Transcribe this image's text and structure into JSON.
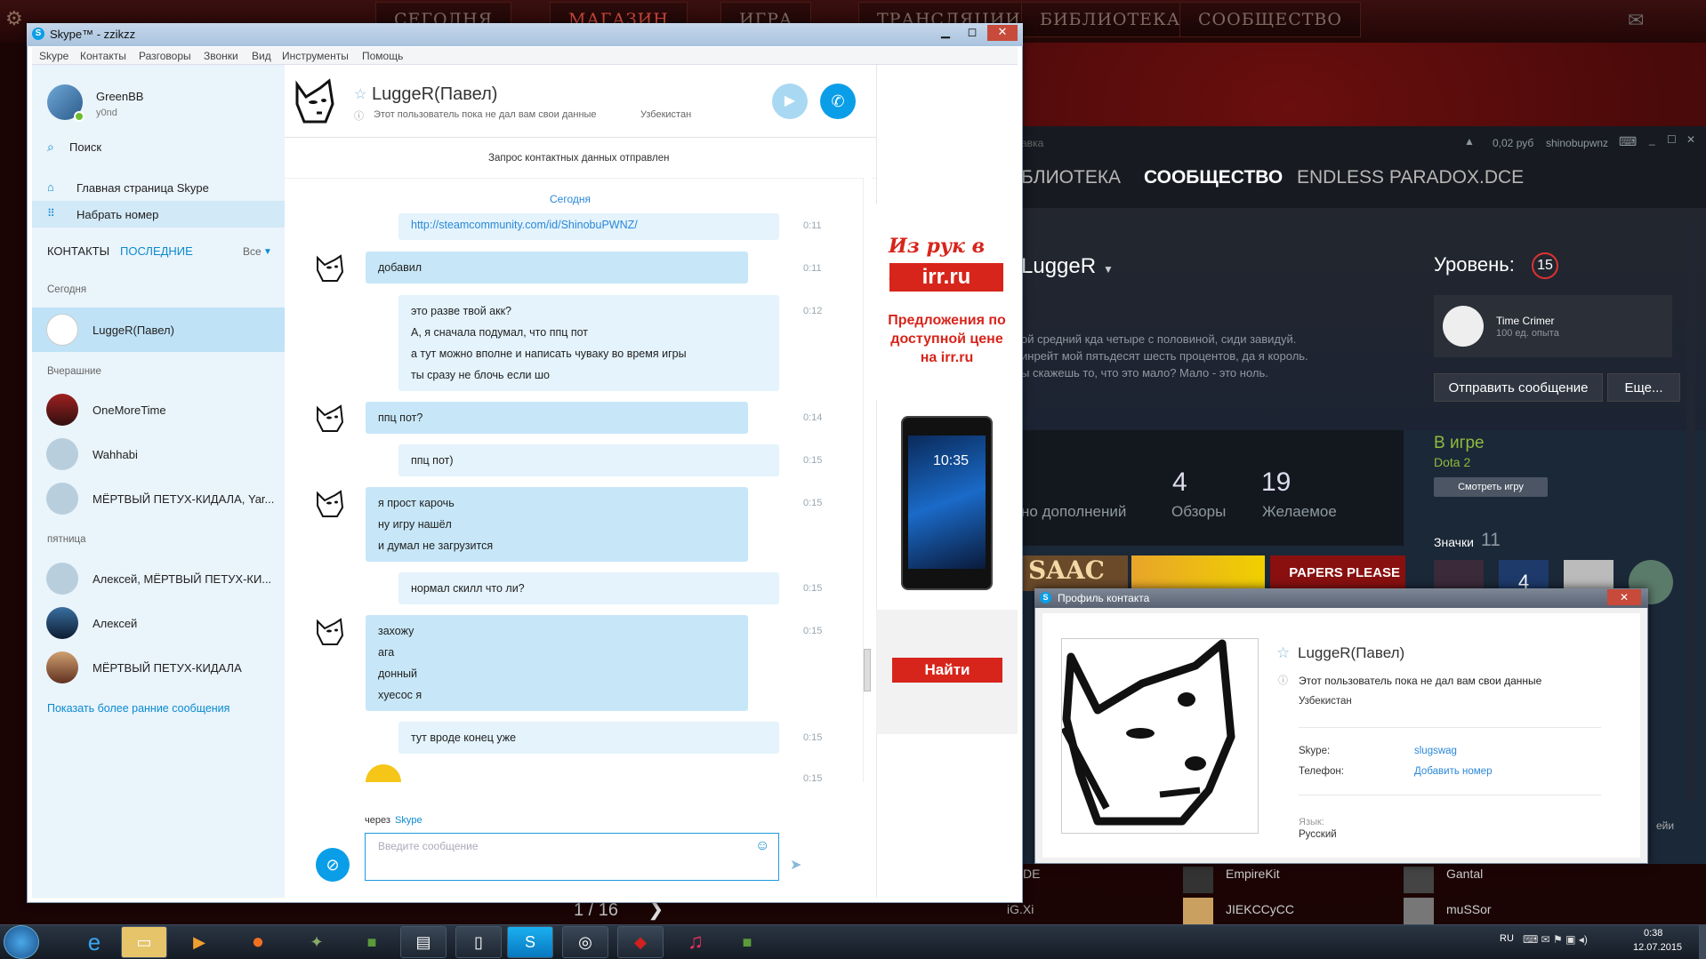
{
  "steam": {
    "tabs": [
      "СЕГОДНЯ",
      "МАГАЗИН",
      "ИГРА",
      "ТРАНСЛЯЦИИ",
      "БИБЛИОТЕКА",
      "СООБЩЕСТВО"
    ],
    "window": {
      "balance": "0,02 руб",
      "account": "shinobupwnz",
      "title_fragment": "авка"
    },
    "nav": [
      "БЛИОТЕКА",
      "СООБЩЕСТВО",
      "ENDLESS PARADOX.DCE"
    ],
    "profile": {
      "name": "LuggeR",
      "bio_lines": [
        "ой средний кда четыре с половиной, сиди завидуй.",
        "инрейт мой пятьдесят шесть процентов, да я король.",
        "ы скажешь то, что это мало? Мало - это ноль."
      ],
      "level_label": "Уровень:",
      "level": "15",
      "badge_name": "Time Crimer",
      "badge_xp": "100 ед. опыта",
      "send_message": "Отправить сообщение",
      "more": "Еще...",
      "status": "В игре",
      "game": "Dota 2",
      "watch_game": "Смотреть игру",
      "badges_label": "Значки",
      "badges_count": "11",
      "stats": [
        {
          "value": "",
          "label": "но дополнений"
        },
        {
          "value": "4",
          "label": "Обзоры"
        },
        {
          "value": "19",
          "label": "Желаемое"
        }
      ],
      "game_tiles": [
        "SAAC",
        "",
        "PAPERS PLEASE"
      ],
      "badge_num": "4"
    },
    "bottom_left": [
      "DE",
      "iG.Xi"
    ],
    "friends": [
      "EmpireKit",
      "JIEKCCyCC",
      "Gantal",
      "muSSor"
    ],
    "bottom_right": "ейи",
    "pager": "1 / 16"
  },
  "skype": {
    "title": "Skype™ - zzikzz",
    "menu": [
      "Skype",
      "Контакты",
      "Разговоры",
      "Звонки",
      "Вид",
      "Инструменты",
      "Помощь"
    ],
    "user": {
      "name": "GreenBB",
      "mood": "y0nd"
    },
    "search": "Поиск",
    "home": "Главная страница Skype",
    "dial": "Набрать номер",
    "tab_contacts": "КОНТАКТЫ",
    "tab_recent": "ПОСЛЕДНИЕ",
    "filter": "Все",
    "sections": {
      "today": "Сегодня",
      "yesterday": "Вчерашние",
      "friday": "пятница"
    },
    "contacts": [
      {
        "name": "LuggeR(Павел)",
        "group": "today",
        "selected": true
      },
      {
        "name": "OneMoreTime",
        "group": "yesterday"
      },
      {
        "name": "Wahhabi",
        "group": "yesterday"
      },
      {
        "name": "МЁРТВЫЙ ПЕТУХ-КИДАЛА, Yar...",
        "group": "yesterday"
      },
      {
        "name": "Алексей, МЁРТВЫЙ ПЕТУХ-КИ...",
        "group": "friday"
      },
      {
        "name": "Алексей",
        "group": "friday"
      },
      {
        "name": "МЁРТВЫЙ ПЕТУХ-КИДАЛА",
        "group": "friday"
      }
    ],
    "show_earlier": "Показать более ранние сообщения",
    "chat": {
      "name": "LuggeR(Павел)",
      "info": "Этот пользователь пока не дал вам свои данные",
      "country": "Узбекистан",
      "request_sent": "Запрос контактных данных отправлен",
      "date": "Сегодня",
      "messages": [
        {
          "from": "me",
          "lines": [
            "http://steamcommunity.com/id/ShinobuPWNZ/"
          ],
          "time": "0:11",
          "link": true
        },
        {
          "from": "them",
          "lines": [
            "добавил"
          ],
          "time": "0:11"
        },
        {
          "from": "me",
          "lines": [
            "это разве твой акк?",
            "А, я сначала подумал, что ппц пот",
            "а тут можно вполне и написать чуваку во время игры",
            "ты сразу не блочь если шо"
          ],
          "time": "0:12"
        },
        {
          "from": "them",
          "lines": [
            "ппц пот?"
          ],
          "time": "0:14"
        },
        {
          "from": "me",
          "lines": [
            "ппц пот)"
          ],
          "time": "0:15"
        },
        {
          "from": "them",
          "lines": [
            "я прост карочь",
            "ну игру нашёл",
            "и думал не загрузится"
          ],
          "time": "0:15"
        },
        {
          "from": "me",
          "lines": [
            "нормал скилл что ли?"
          ],
          "time": "0:15"
        },
        {
          "from": "them",
          "lines": [
            "захожу",
            "ага",
            "донный",
            "хуесос я"
          ],
          "time": "0:15"
        },
        {
          "from": "me",
          "lines": [
            "тут вроде конец уже"
          ],
          "time": "0:15"
        }
      ],
      "last_time": "0:15",
      "via": "через",
      "via_app": "Skype",
      "input_placeholder": "Введите сообщение"
    },
    "ad": {
      "slogan": "Из рук в руки",
      "brand": "irr.ru",
      "offer": "Предложения по доступной цене на irr.ru",
      "phone_time": "10:35",
      "button": "Найти"
    }
  },
  "profile_dialog": {
    "title": "Профиль контакта",
    "name": "LuggeR(Павел)",
    "info": "Этот пользователь пока не дал вам свои данные",
    "country": "Узбекистан",
    "skype_label": "Skype:",
    "skype_value": "slugswag",
    "phone_label": "Телефон:",
    "phone_value": "Добавить номер",
    "lang_label": "Язык:",
    "lang_value": "Русский"
  },
  "taskbar": {
    "lang": "RU",
    "time": "0:38",
    "date": "12.07.2015"
  }
}
